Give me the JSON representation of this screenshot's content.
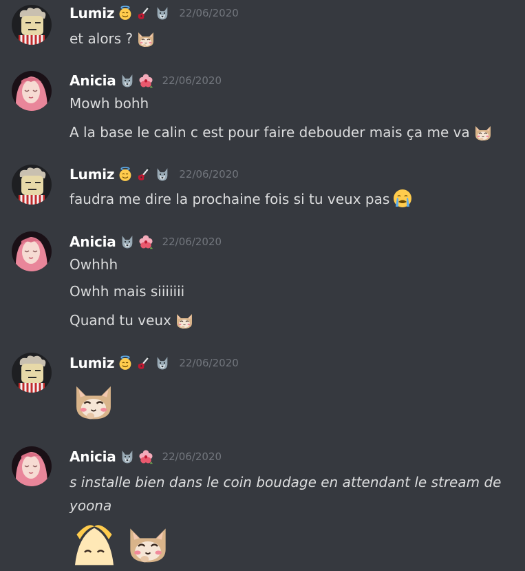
{
  "messages": [
    {
      "author": "Lumiz",
      "timestamp": "22/06/2020",
      "lines": [
        "et alors ?"
      ]
    },
    {
      "author": "Anicia",
      "timestamp": "22/06/2020",
      "lines": [
        "Mowh bohh",
        "A la base le calin c est pour faire debouder mais ça me va"
      ]
    },
    {
      "author": "Lumiz",
      "timestamp": "22/06/2020",
      "lines": [
        "faudra me dire la prochaine fois si tu veux pas"
      ]
    },
    {
      "author": "Anicia",
      "timestamp": "22/06/2020",
      "lines": [
        "Owhhh",
        "Owhh mais siiiiiii",
        "Quand tu veux"
      ]
    },
    {
      "author": "Lumiz",
      "timestamp": "22/06/2020",
      "lines": []
    },
    {
      "author": "Anicia",
      "timestamp": "22/06/2020",
      "lines": [
        "s installe bien dans le coin boudage en attendant le stream de yoona"
      ]
    }
  ],
  "icons": {
    "lumiz_badges": [
      "angel-face-icon",
      "guitar-icon",
      "wolf-icon"
    ],
    "anicia_badges": [
      "wolf-icon",
      "hibiscus-icon"
    ],
    "inline_emojis": [
      "blushing-cat-emoji",
      "crying-face-emoji"
    ]
  },
  "colors": {
    "background": "#36393f",
    "username": "#ffffff",
    "message_text": "#dcddde",
    "timestamp": "#72767d"
  }
}
